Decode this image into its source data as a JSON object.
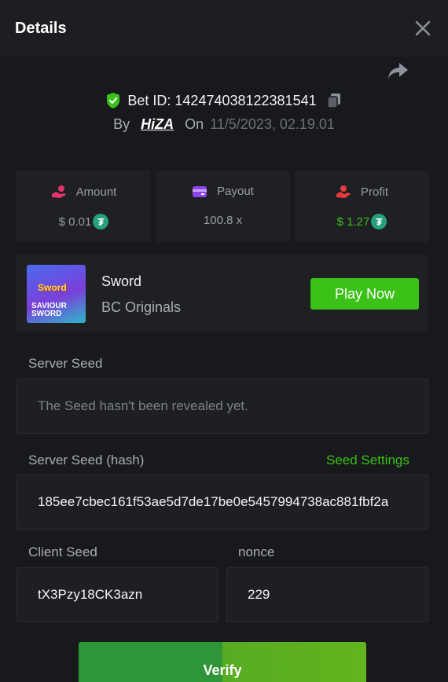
{
  "header": {
    "title": "Details"
  },
  "bet": {
    "id_text": "Bet ID: 142474038122381541",
    "by_label": "By",
    "user": "HiZA",
    "on_label": "On",
    "date": "11/5/2023, 02.19.01"
  },
  "stats": [
    {
      "label": "Amount",
      "value": "$ 0.01",
      "color": "#9a9da5"
    },
    {
      "label": "Payout",
      "value": "100.8 x",
      "color": "#9a9da5"
    },
    {
      "label": "Profit",
      "value": "$ 1.27",
      "color": "#3bc117"
    }
  ],
  "game": {
    "name": "Sword",
    "provider": "BC Originals",
    "play_label": "Play Now",
    "thumb_title": "Sword",
    "thumb_sub": "SAVIOUR SWORD"
  },
  "server_seed": {
    "label": "Server Seed",
    "value": "The Seed hasn't been revealed yet."
  },
  "server_seed_hash": {
    "label": "Server Seed (hash)",
    "settings_link": "Seed Settings",
    "value": "185ee7cbec161f53ae5d7de17be0e5457994738ac881fbf2a"
  },
  "client_seed": {
    "label": "Client Seed",
    "value": "tX3Pzy18CK3azn"
  },
  "nonce": {
    "label": "nonce",
    "value": "229"
  },
  "verify_label": "Verify",
  "icons": {
    "close": "close-icon",
    "share": "share-icon",
    "verified": "shield-check-icon",
    "copy": "copy-icon",
    "amount": "coins-hand-icon",
    "payout": "card-icon",
    "profit": "profit-hand-icon",
    "currency": "tether-icon"
  },
  "colors": {
    "accent": "#3bc117",
    "background": "#18191d",
    "panel": "#1f2024",
    "tether": "#26a17b"
  }
}
